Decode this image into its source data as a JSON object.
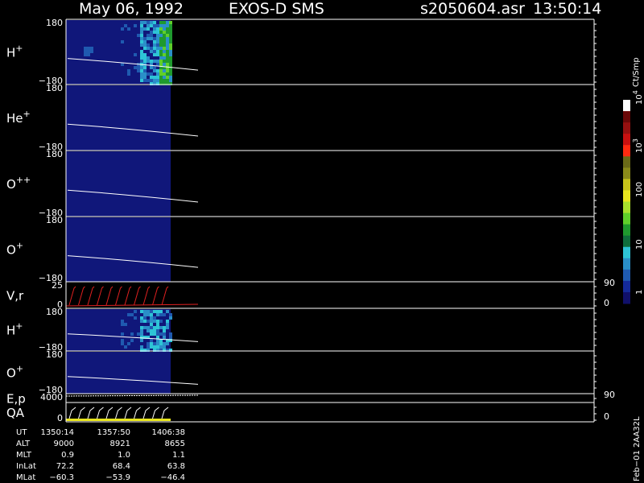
{
  "header": {
    "date": "May 06, 1992",
    "instrument": "EXOS-D SMS",
    "file": "s2050604.asr",
    "time": "13:50:14"
  },
  "colorbar": {
    "unit": "Ct/Smp",
    "ticks": [
      "1",
      "10",
      "100",
      "10",
      "10"
    ],
    "tick_exponents": [
      "",
      "",
      "",
      "3",
      "4"
    ],
    "colors": [
      "#10106a",
      "#142a9a",
      "#1f5ab0",
      "#2a8fc8",
      "#2ec4d6",
      "#0f6e3c",
      "#1f9a2e",
      "#5fcf2a",
      "#a8e02c",
      "#e8e51e",
      "#c8c41a",
      "#8a8a1a",
      "#6a6a18",
      "#ff2a10",
      "#c81010",
      "#961010",
      "#6a0808",
      "#ffffff"
    ]
  },
  "panels": [
    {
      "label": "H",
      "sup": "+",
      "ymax": "180",
      "ymin": "−180"
    },
    {
      "label": "He",
      "sup": "+",
      "ymax": "180",
      "ymin": "−180"
    },
    {
      "label": "O",
      "sup": "++",
      "ymax": "180",
      "ymin": "−180"
    },
    {
      "label": "O",
      "sup": "+",
      "ymax": "180",
      "ymin": "−180"
    },
    {
      "label": "V,r",
      "sup": "",
      "ymax": "25",
      "ymin": "0",
      "right_top": "90",
      "right_bottom": "0"
    },
    {
      "label": "H",
      "sup": "+",
      "ymax": "180",
      "ymin": "−180"
    },
    {
      "label": "O",
      "sup": "+",
      "ymax": "180",
      "ymin": "−180"
    },
    {
      "label": "E,p",
      "sup": "",
      "ymax": "4000",
      "ymin": "",
      "right_top": "90",
      "right_bottom": ""
    },
    {
      "label": "QA",
      "sup": "",
      "ymax": "",
      "ymin": "0",
      "right_top": "",
      "right_bottom": "0"
    }
  ],
  "chart_data": {
    "type": "heatmap",
    "xlabel": "UT",
    "y_ticks": [
      "180",
      "−180"
    ],
    "colorscale_unit": "Ct/Smp",
    "colorscale_log": true,
    "colorscale_range": [
      1,
      10000
    ]
  },
  "footer": {
    "rows": [
      {
        "label": "UT",
        "values": [
          "1350:14",
          "1357:50",
          "1406:38"
        ]
      },
      {
        "label": "ALT",
        "values": [
          "9000",
          "8921",
          "8655"
        ]
      },
      {
        "label": "MLT",
        "values": [
          "0.9",
          "1.0",
          "1.1"
        ]
      },
      {
        "label": "InLat",
        "values": [
          "72.2",
          "68.4",
          "63.8"
        ]
      },
      {
        "label": "MLat",
        "values": [
          "−60.3",
          "−53.9",
          "−46.4"
        ]
      }
    ],
    "side_text": "Feb−01 2AA32L"
  }
}
